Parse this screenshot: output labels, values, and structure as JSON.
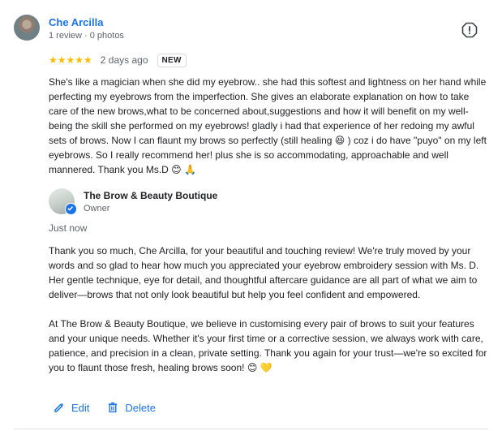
{
  "review": {
    "reviewer_name": "Che Arcilla",
    "reviewer_meta": "1 review · 0 photos",
    "stars": "★★★★★",
    "rating": 5,
    "time": "2 days ago",
    "badge": "NEW",
    "text": "She's like a magician when she did my eyebrow.. she had this softest and lightness on her hand while perfecting my eyebrows from the imperfection. She gives an elaborate explanation on how to take care of the new brows,what to be concerned about,suggestions and how it will benefit on my well-being the skill she performed on my eyebrows! gladly i had that experience of her redoing my awful sets of brows. Now I can flaunt my brows so perfectly (still healing 😆 ) coz i do have \"puyo\" on my left eyebrows. So I really recommend her! plus she is so accommodating, approachable and well mannered. Thank you Ms.D 😊 🙏"
  },
  "owner_reply": {
    "name": "The Brow & Beauty Boutique",
    "role": "Owner",
    "time": "Just now",
    "paragraph1": "Thank you so much, Che Arcilla, for your beautiful and touching review! We're truly moved by your words and so glad to hear how much you appreciated your eyebrow embroidery session with Ms. D. Her gentle technique, eye for detail, and thoughtful aftercare guidance are all part of what we aim to deliver—brows that not only look beautiful but help you feel confident and empowered.",
    "paragraph2": "At The Brow & Beauty Boutique, we believe in customising every pair of brows to suit your features and your unique needs. Whether it's your first time or a corrective session, we always work with care, patience, and precision in a clean, private setting. Thank you again for your trust—we're so excited for you to flaunt those fresh, healing brows soon! 😊 💛"
  },
  "actions": {
    "edit_label": "Edit",
    "delete_label": "Delete"
  },
  "icons": {
    "flag": "report-flag-icon",
    "edit": "pencil-icon",
    "delete": "trash-icon",
    "verified": "verified-check-icon"
  },
  "colors": {
    "accent": "#1a73e8",
    "stars": "#fbbc04",
    "text": "#202124",
    "muted": "#5f6368"
  }
}
